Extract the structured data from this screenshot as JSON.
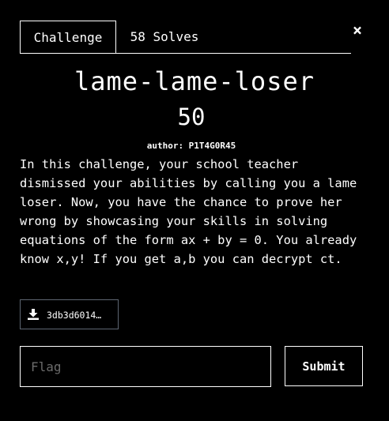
{
  "tabs": {
    "challenge_label": "Challenge",
    "solves_label": "58 Solves"
  },
  "close_icon": "×",
  "challenge": {
    "name": "lame-lame-loser",
    "value": "50",
    "author": "author: P1T4G0R45",
    "description": "In this challenge, your school teacher dismissed your abilities by calling you a lame loser. Now, you have the chance to prove her wrong by showcasing your skills in solving equations of the form ax + by = 0. You already know x,y! If you get a,b you can decrypt ct."
  },
  "file": {
    "icon": "download-icon",
    "name": "3db3d6014…"
  },
  "flag": {
    "placeholder": "Flag",
    "value": ""
  },
  "submit_label": "Submit"
}
